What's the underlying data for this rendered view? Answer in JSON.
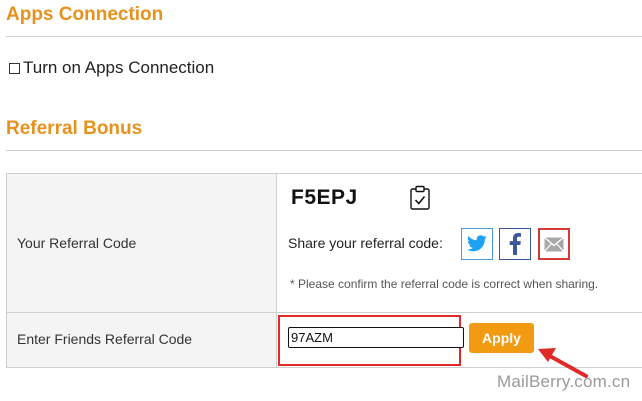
{
  "apps_connection": {
    "title": "Apps Connection",
    "checkbox_label": "Turn on Apps Connection",
    "checked": false
  },
  "referral_bonus": {
    "title": "Referral Bonus",
    "your_code_label": "Your Referral Code",
    "code": "F5EPJ",
    "share_label": "Share your referral code:",
    "share_buttons": [
      {
        "name": "twitter-icon",
        "color": "#1da1f2"
      },
      {
        "name": "facebook-icon",
        "color": "#3b5998"
      },
      {
        "name": "email-icon",
        "color": "#999999"
      }
    ],
    "note": "* Please confirm the referral code is correct when sharing.",
    "friend_code_label": "Enter Friends Referral Code",
    "friend_code_value": "97AZM",
    "apply_label": "Apply"
  },
  "colors": {
    "accent": "#e8921e",
    "button": "#f29a12",
    "highlight": "#e02a2a"
  },
  "watermark": "MailBerry.com.cn"
}
